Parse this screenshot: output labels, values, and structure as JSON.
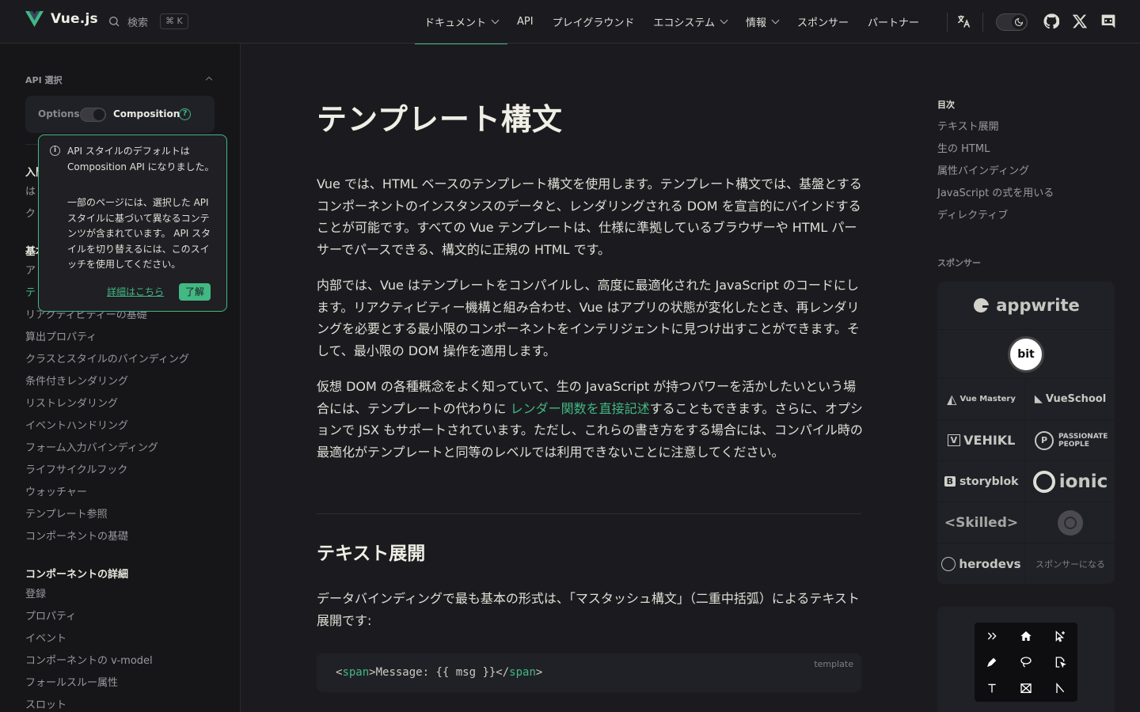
{
  "nav": {
    "brand": "Vue.js",
    "search_label": "検索",
    "search_shortcut": "⌘ K",
    "links": [
      {
        "label": "ドキュメント",
        "dropdown": true
      },
      {
        "label": "API",
        "dropdown": false
      },
      {
        "label": "プレイグラウンド",
        "dropdown": false
      },
      {
        "label": "エコシステム",
        "dropdown": true
      },
      {
        "label": "情報",
        "dropdown": true
      },
      {
        "label": "スポンサー",
        "dropdown": false
      },
      {
        "label": "パートナー",
        "dropdown": false
      }
    ],
    "accent": "#42b883"
  },
  "sidebar": {
    "api_pref_title": "API 選択",
    "options_label": "Options",
    "composition_label": "Composition",
    "help_glyph": "?",
    "groups": [
      {
        "title": "入門",
        "items": [
          "は",
          "ク"
        ]
      },
      {
        "title": "基本",
        "items": [
          "ア",
          "テ",
          "リアクティビティーの基礎",
          "算出プロパティ",
          "クラスとスタイルのバインディング",
          "条件付きレンダリング",
          "リストレンダリング",
          "イベントハンドリング",
          "フォーム入力バインディング",
          "ライフサイクルフック",
          "ウォッチャー",
          "テンプレート参照",
          "コンポーネントの基礎"
        ]
      },
      {
        "title": "コンポーネントの詳細",
        "items": [
          "登録",
          "プロパティ",
          "イベント",
          "コンポーネントの v-model",
          "フォールスルー属性",
          "スロット"
        ]
      }
    ],
    "popup": {
      "text1": "API スタイルのデフォルトは Composition API になりました。",
      "text2": "一部のページには、選択した API スタイルに基づいて異なるコンテンツが含まれています。 API スタイルを切り替えるには、このスイッチを使用してください。",
      "link": "詳細はこちら",
      "button": "了解"
    }
  },
  "main": {
    "title": "テンプレート構文",
    "p1": "Vue では、HTML ベースのテンプレート構文を使用します。テンプレート構文では、基盤とするコンポーネントのインスタンスのデータと、レンダリングされる DOM を宣言的にバインドすることが可能です。すべての Vue テンプレートは、仕様に準拠しているブラウザーや HTML パーサーでパースできる、構文的に正規の HTML です。",
    "p2": "内部では、Vue はテンプレートをコンパイルし、高度に最適化された JavaScript のコードにします。リアクティビティー機構と組み合わせ、Vue はアプリの状態が変化したとき、再レンダリングを必要とする最小限のコンポーネントをインテリジェントに見つけ出すことができます。そして、最小限の DOM 操作を適用します。",
    "p3_before": "仮想 DOM の各種概念をよく知っていて、生の JavaScript が持つパワーを活かしたいという場合には、テンプレートの代わりに ",
    "p3_link": "レンダー関数を直接記述",
    "p3_after": "することもできます。さらに、オプションで JSX もサポートされています。ただし、これらの書き方をする場合には、コンパイル時の最適化がテンプレートと同等のレベルでは利用できないことに注意してください。",
    "h2": "テキスト展開",
    "p4": "データバインディングで最も基本の形式は、「マスタッシュ構文」（二重中括弧）によるテキスト展開です:",
    "code_lang": "template",
    "code_open": "<",
    "code_tag": "span",
    "code_mid": ">Message: {{ msg }}</",
    "code_tag2": "span",
    "code_close": ">"
  },
  "aside": {
    "toc_title": "目次",
    "toc": [
      "テキスト展開",
      "生の HTML",
      "属性バインディング",
      "JavaScript の式を用いる",
      "ディレクティブ"
    ],
    "sponsor_title": "スポンサー",
    "sponsors": [
      "appwrite",
      "bit",
      "Vue Mastery",
      "VueSchool",
      "VEHIKL",
      "PASSIONATE PEOPLE",
      "storyblok",
      "ionic",
      "<Skilled>",
      "",
      "herodevs",
      "スポンサーになる"
    ]
  }
}
